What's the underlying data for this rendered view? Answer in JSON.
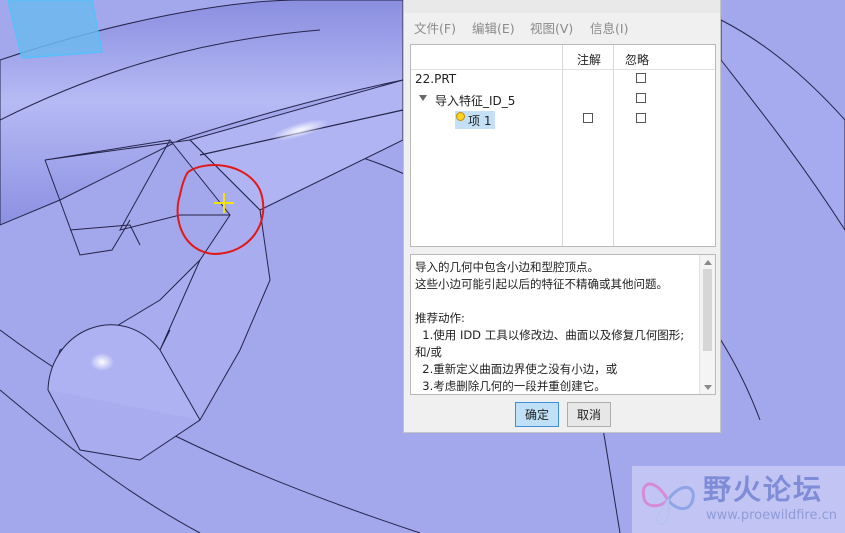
{
  "dialog": {
    "title": "",
    "menu": [
      "文件(F)",
      "编辑(E)",
      "视图(V)",
      "信息(I)"
    ],
    "columns": {
      "resolve": "注解",
      "ignore": "忽略"
    },
    "tree": [
      {
        "label": "22.PRT"
      },
      {
        "label": "导入特征_ID_5"
      },
      {
        "label": "项 1"
      }
    ],
    "message": [
      "导入的几何中包含小边和型腔顶点。",
      "这些小边可能引起以后的特征不精确或其他问题。",
      "",
      "推荐动作:",
      "  1.使用 IDD 工具以修改边、曲面以及修复几何图形;",
      "和/或",
      "  2.重新定义曲面边界使之没有小边，或",
      "  3.考虑删除几何的一段并重创建它。"
    ],
    "ok_label": "确定",
    "cancel_label": "取消"
  },
  "watermark": {
    "name": "野火论坛",
    "url": "www.proewildfire.cn"
  },
  "colors": {
    "model_fill": "#a4a8ec",
    "model_highlight": "#c9ccf6",
    "edge": "#1e1e46",
    "annotation_circle": "#e11818",
    "cursor": "#f2e600",
    "selection": "#c4e0f7"
  }
}
